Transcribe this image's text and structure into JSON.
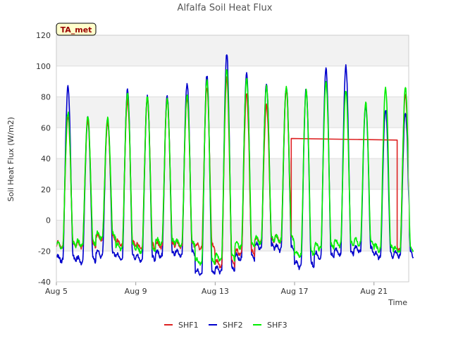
{
  "chart_data": {
    "type": "line",
    "title": "Alfalfa Soil Heat Flux",
    "xlabel": "Time",
    "ylabel": "Soil Heat Flux (W/m2)",
    "xlim": [
      "2023-08-05",
      "2023-08-22T18:00"
    ],
    "ylim": [
      -40,
      120
    ],
    "x_ticks": [
      {
        "label": "Aug 5",
        "date": "2023-08-05"
      },
      {
        "label": "Aug 9",
        "date": "2023-08-09"
      },
      {
        "label": "Aug 13",
        "date": "2023-08-13"
      },
      {
        "label": "Aug 17",
        "date": "2023-08-17"
      },
      {
        "label": "Aug 21",
        "date": "2023-08-21"
      }
    ],
    "y_ticks": [
      -40,
      -20,
      0,
      20,
      40,
      60,
      80,
      100,
      120
    ],
    "grid": true,
    "legend_position": "bottom",
    "annotation": "TA_met",
    "series": [
      {
        "name": "SHF1",
        "color": "#dd2222",
        "daily": [
          {
            "date": "2023-08-05",
            "min": -16,
            "peak": 68
          },
          {
            "date": "2023-08-06",
            "min": -16,
            "peak": 65
          },
          {
            "date": "2023-08-07",
            "min": -11,
            "peak": 63
          },
          {
            "date": "2023-08-08",
            "min": -15,
            "peak": 78
          },
          {
            "date": "2023-08-09",
            "min": -17,
            "peak": 79
          },
          {
            "date": "2023-08-10",
            "min": -16,
            "peak": 78
          },
          {
            "date": "2023-08-11",
            "min": -16,
            "peak": 80
          },
          {
            "date": "2023-08-12",
            "min": -17,
            "peak": 86
          },
          {
            "date": "2023-08-13",
            "min": -28,
            "peak": 92
          },
          {
            "date": "2023-08-14",
            "min": -21,
            "peak": 82
          },
          {
            "date": "2023-08-15",
            "min": -13,
            "peak": 75
          },
          {
            "date": "2023-08-16",
            "min": -12,
            "peak": 84
          }
        ],
        "flat_segment": {
          "start": "2023-08-16T20:00",
          "end": "2023-08-22T04:00",
          "y_start": 53,
          "y_end": 52
        },
        "tail": {
          "date": "2023-08-22",
          "min": -17,
          "peak": 82
        }
      },
      {
        "name": "SHF2",
        "color": "#0000cc",
        "daily": [
          {
            "date": "2023-08-05",
            "min": -25,
            "peak": 87
          },
          {
            "date": "2023-08-06",
            "min": -26,
            "peak": 66
          },
          {
            "date": "2023-08-07",
            "min": -22,
            "peak": 65
          },
          {
            "date": "2023-08-08",
            "min": -24,
            "peak": 85
          },
          {
            "date": "2023-08-09",
            "min": -25,
            "peak": 80
          },
          {
            "date": "2023-08-10",
            "min": -22,
            "peak": 80
          },
          {
            "date": "2023-08-11",
            "min": -21,
            "peak": 89
          },
          {
            "date": "2023-08-12",
            "min": -34,
            "peak": 94
          },
          {
            "date": "2023-08-13",
            "min": -32,
            "peak": 108
          },
          {
            "date": "2023-08-14",
            "min": -24,
            "peak": 96
          },
          {
            "date": "2023-08-15",
            "min": -17,
            "peak": 88
          },
          {
            "date": "2023-08-16",
            "min": -18,
            "peak": 86
          },
          {
            "date": "2023-08-17",
            "min": -29,
            "peak": 85
          },
          {
            "date": "2023-08-18",
            "min": -23,
            "peak": 98
          },
          {
            "date": "2023-08-19",
            "min": -21,
            "peak": 100
          },
          {
            "date": "2023-08-20",
            "min": -19,
            "peak": 75
          },
          {
            "date": "2023-08-21",
            "min": -23,
            "peak": 72
          },
          {
            "date": "2023-08-22",
            "min": -22,
            "peak": 70
          }
        ]
      },
      {
        "name": "SHF3",
        "color": "#00ee00",
        "daily": [
          {
            "date": "2023-08-05",
            "min": -16,
            "peak": 70
          },
          {
            "date": "2023-08-06",
            "min": -15,
            "peak": 67
          },
          {
            "date": "2023-08-07",
            "min": -10,
            "peak": 66
          },
          {
            "date": "2023-08-08",
            "min": -17,
            "peak": 82
          },
          {
            "date": "2023-08-09",
            "min": -19,
            "peak": 80
          },
          {
            "date": "2023-08-10",
            "min": -14,
            "peak": 79
          },
          {
            "date": "2023-08-11",
            "min": -15,
            "peak": 82
          },
          {
            "date": "2023-08-12",
            "min": -27,
            "peak": 91
          },
          {
            "date": "2023-08-13",
            "min": -24,
            "peak": 98
          },
          {
            "date": "2023-08-14",
            "min": -16,
            "peak": 92
          },
          {
            "date": "2023-08-15",
            "min": -13,
            "peak": 87
          },
          {
            "date": "2023-08-16",
            "min": -12,
            "peak": 86
          },
          {
            "date": "2023-08-17",
            "min": -22,
            "peak": 84
          },
          {
            "date": "2023-08-18",
            "min": -17,
            "peak": 89
          },
          {
            "date": "2023-08-19",
            "min": -15,
            "peak": 84
          },
          {
            "date": "2023-08-20",
            "min": -14,
            "peak": 76
          },
          {
            "date": "2023-08-21",
            "min": -18,
            "peak": 86
          },
          {
            "date": "2023-08-22",
            "min": -19,
            "peak": 86
          }
        ]
      }
    ]
  }
}
